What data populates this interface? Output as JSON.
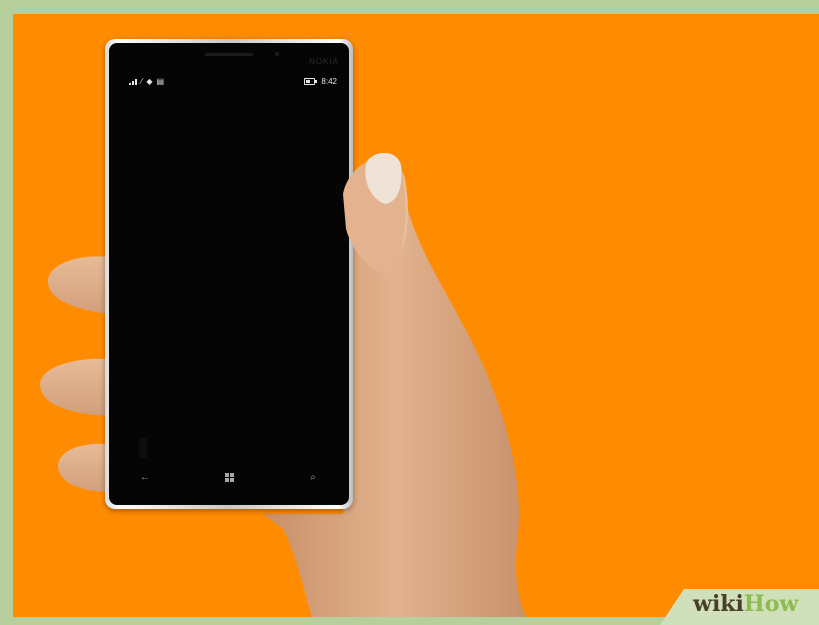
{
  "image": {
    "description_colors": {
      "background": "#ff8c00",
      "frame": "#b7cf9d",
      "phone_screen": "#050505"
    }
  },
  "phone": {
    "brand": "NOKIA",
    "status_bar": {
      "time": "8:42"
    },
    "nav_icons": [
      "back-arrow-icon",
      "windows-logo-icon",
      "search-icon"
    ]
  },
  "watermark": {
    "part1": "wiki",
    "part2": "How"
  }
}
